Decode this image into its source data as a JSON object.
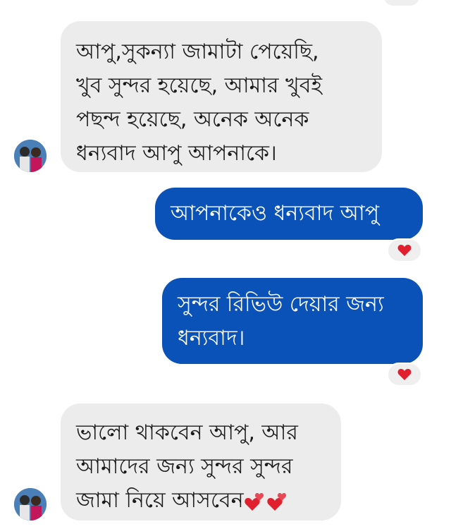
{
  "messages": [
    {
      "direction": "incoming",
      "text": "আপু,সুকন্যা জামাটা পেয়েছি,\nখুব সুন্দর হয়েছে, আমার খুবই\nপছন্দ হয়েছে, অনেক অনেক\nধন্যবাদ আপু আপনাকে।"
    },
    {
      "direction": "outgoing",
      "text": "আপনাকেও ধন্যবাদ আপু",
      "reaction": "heart-icon"
    },
    {
      "direction": "outgoing",
      "text": "সুন্দর রিভিউ দেয়ার জন্য\nধন্যবাদ।",
      "reaction": "heart-icon"
    },
    {
      "direction": "incoming",
      "text_lines": [
        "ভালো থাকবেন আপু, আর",
        "আমাদের জন্য সুন্দর সুন্দর",
        "জামা নিয়ে আসবেন"
      ],
      "trailing_emoji": [
        "two-hearts-icon",
        "two-hearts-icon"
      ]
    }
  ],
  "colors": {
    "incoming_bubble": "#ececec",
    "outgoing_bubble": "#0a52b8",
    "reaction_heart": "#e0202e"
  }
}
